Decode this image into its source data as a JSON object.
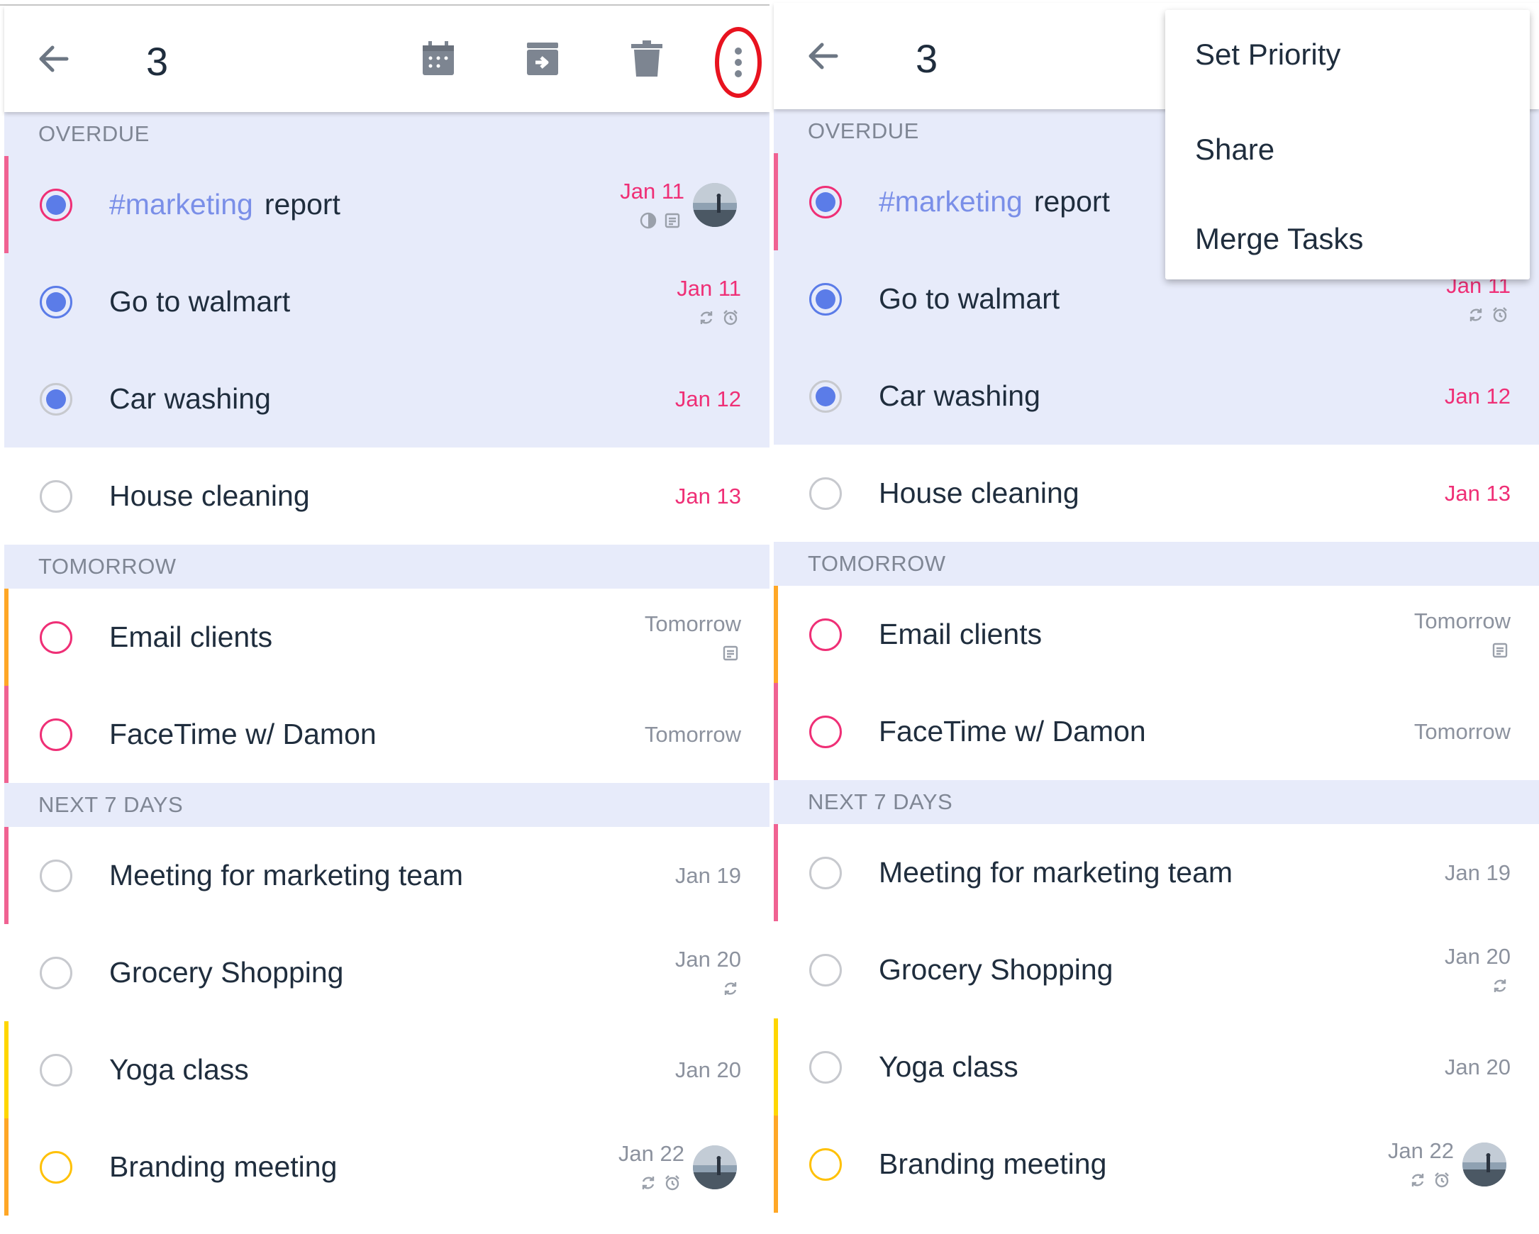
{
  "toolbar": {
    "count": "3",
    "icons": [
      "back-arrow-icon",
      "calendar-icon",
      "move-to-icon",
      "trash-icon",
      "more-vertical-icon"
    ]
  },
  "menu": {
    "items": [
      "Set Priority",
      "Share",
      "Merge Tasks"
    ]
  },
  "sections": {
    "overdue": "OVERDUE",
    "tomorrow": "TOMORROW",
    "next7": "NEXT 7 DAYS"
  },
  "tasks": [
    {
      "tag": "#marketing",
      "title": "report",
      "date": "Jan 11",
      "icons": [
        "progress-icon",
        "note-icon"
      ],
      "avatar": true,
      "selected": true,
      "priority_color": "#f06292",
      "check_color": "#ef2f76"
    },
    {
      "tag": "",
      "title": "Go to walmart",
      "date": "Jan 11",
      "icons": [
        "repeat-icon",
        "alarm-icon"
      ],
      "avatar": false,
      "selected": true,
      "priority_color": "",
      "check_color": "#5b7ce8"
    },
    {
      "tag": "",
      "title": "Car washing",
      "date": "Jan 12",
      "icons": [],
      "avatar": false,
      "selected": true,
      "priority_color": "",
      "check_color": "#c7c9ce"
    },
    {
      "tag": "",
      "title": "House cleaning",
      "date": "Jan 13",
      "icons": [],
      "avatar": false,
      "selected": false,
      "priority_color": "",
      "check_color": "#c7c9ce"
    },
    {
      "tag": "",
      "title": "Email clients",
      "date": "Tomorrow",
      "icons": [
        "note-icon"
      ],
      "avatar": false,
      "selected": false,
      "priority_color": "#ffa726",
      "check_color": "#ef2f76"
    },
    {
      "tag": "",
      "title": "FaceTime w/ Damon",
      "date": "Tomorrow",
      "icons": [],
      "avatar": false,
      "selected": false,
      "priority_color": "#f06292",
      "check_color": "#ef2f76"
    },
    {
      "tag": "",
      "title": "Meeting for marketing team",
      "date": "Jan 19",
      "icons": [],
      "avatar": false,
      "selected": false,
      "priority_color": "#f06292",
      "check_color": "#c7c9ce"
    },
    {
      "tag": "",
      "title": "Grocery Shopping",
      "date": "Jan 20",
      "icons": [
        "repeat-icon"
      ],
      "avatar": false,
      "selected": false,
      "priority_color": "",
      "check_color": "#c7c9ce"
    },
    {
      "tag": "",
      "title": "Yoga class",
      "date": "Jan 20",
      "icons": [],
      "avatar": false,
      "selected": false,
      "priority_color": "#ffd600",
      "check_color": "#c7c9ce"
    },
    {
      "tag": "",
      "title": "Branding meeting",
      "date": "Jan 22",
      "icons": [
        "repeat-icon",
        "alarm-icon"
      ],
      "avatar": true,
      "selected": false,
      "priority_color": "#ffa726",
      "check_color": "#ffc107"
    }
  ],
  "colors": {
    "accent": "#5b7ce8",
    "overdue": "#ef2f76",
    "section_bg": "#e7ebfa",
    "highlight_ring": "#e8131f"
  }
}
